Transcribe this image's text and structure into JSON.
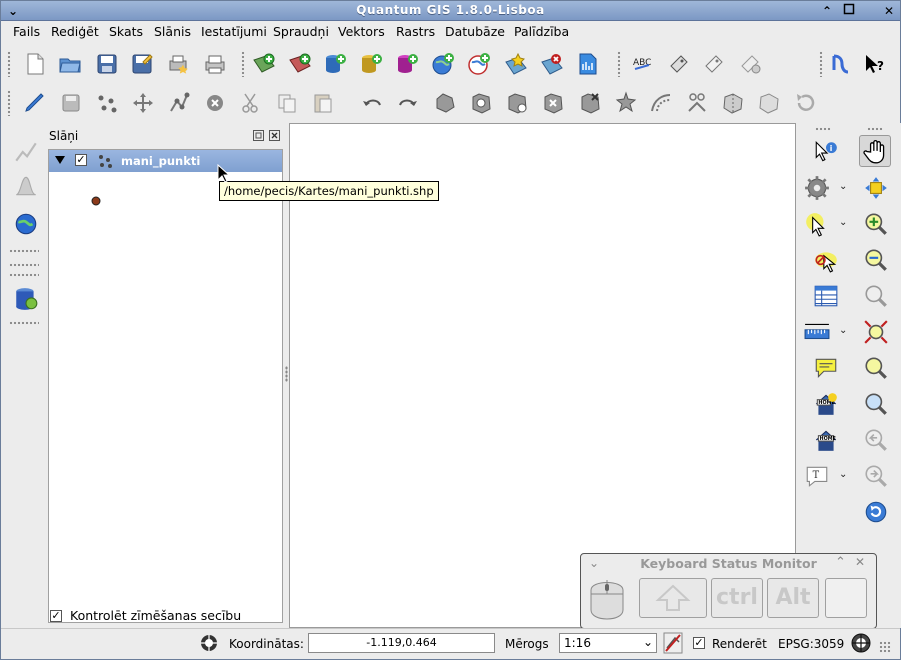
{
  "window": {
    "title": "Quantum GIS 1.8.0-Lisboa"
  },
  "menu": [
    "Fails",
    "Rediģēt",
    "Skats",
    "Slānis",
    "Iestatījumi",
    "Spraudņi",
    "Vektors",
    "Rastrs",
    "Datubāze",
    "Palīdzība"
  ],
  "layers_panel": {
    "title": "Slāņi",
    "layer_name": "mani_punkti",
    "tooltip": "/home/pecis/Kartes/mani_punkti.shp",
    "render_order_label": "Kontrolēt zīmēšanas secību"
  },
  "statusbar": {
    "coord_label": "Koordinātas:",
    "coord_value": "-1.119,0.464",
    "scale_label": "Mērogs",
    "scale_value": "1:16",
    "render_label": "Renderēt",
    "crs": "EPSG:3059"
  },
  "keyboard_monitor": {
    "title": "Keyboard Status Monitor",
    "keys": [
      "ctrl",
      "Alt"
    ]
  }
}
